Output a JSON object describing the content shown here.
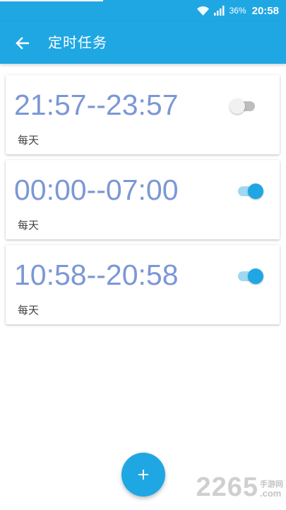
{
  "status_bar": {
    "battery": "36%",
    "time": "20:58",
    "icons": [
      "wifi-icon",
      "signal-icon"
    ]
  },
  "app_bar": {
    "title": "定时任务",
    "back_icon": "arrow-left-icon"
  },
  "tasks": [
    {
      "time_range": "21:57--23:57",
      "repeat": "每天",
      "enabled": false
    },
    {
      "time_range": "00:00--07:00",
      "repeat": "每天",
      "enabled": true
    },
    {
      "time_range": "10:58--20:58",
      "repeat": "每天",
      "enabled": true
    }
  ],
  "fab": {
    "label": "+",
    "icon": "plus-icon"
  },
  "watermark": {
    "main": "2265",
    "cn": "手游网",
    "suffix": ".com"
  },
  "colors": {
    "accent": "#1fa7e3",
    "time_text": "#7b97d6",
    "toggle_on_track": "#9fd8f2",
    "toggle_off_track": "#bdbdbd"
  }
}
